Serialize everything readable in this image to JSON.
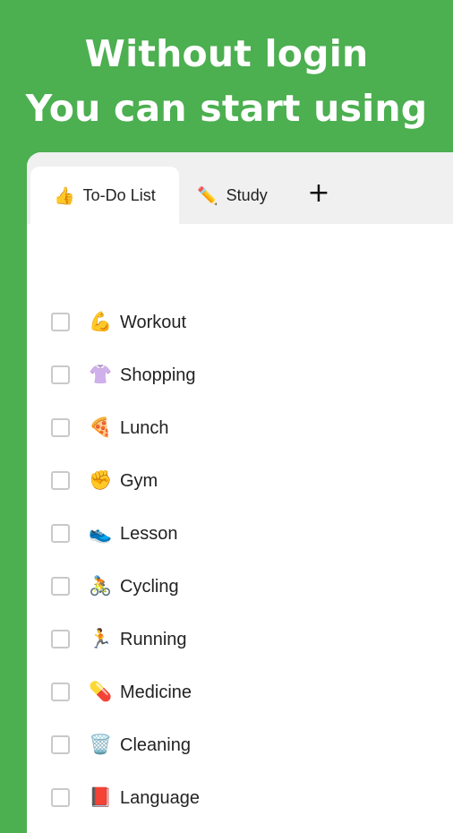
{
  "headline": {
    "line1": "Without login",
    "line2": "You can start using"
  },
  "tabs": [
    {
      "emoji": "👍",
      "label": "To-Do List",
      "active": true
    },
    {
      "emoji": "✏️",
      "label": "Study",
      "active": false
    }
  ],
  "add_tab_label": "+",
  "todos": [
    {
      "emoji": "💪",
      "label": "Workout",
      "checked": false
    },
    {
      "emoji": "👚",
      "label": "Shopping",
      "checked": false
    },
    {
      "emoji": "🍕",
      "label": "Lunch",
      "checked": false
    },
    {
      "emoji": "✊",
      "label": "Gym",
      "checked": false
    },
    {
      "emoji": "👟",
      "label": "Lesson",
      "checked": false
    },
    {
      "emoji": "🚴",
      "label": "Cycling",
      "checked": false
    },
    {
      "emoji": "🏃",
      "label": "Running",
      "checked": false
    },
    {
      "emoji": "💊",
      "label": "Medicine",
      "checked": false
    },
    {
      "emoji": "🗑️",
      "label": "Cleaning",
      "checked": false
    },
    {
      "emoji": "📕",
      "label": "Language",
      "checked": false
    }
  ],
  "colors": {
    "brand_green": "#4CAF50",
    "tab_bar": "#f0f0f0",
    "checkbox_border": "#c9c9c9"
  }
}
